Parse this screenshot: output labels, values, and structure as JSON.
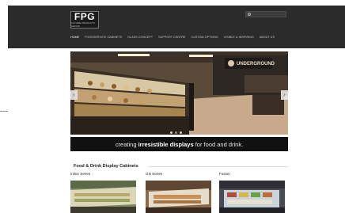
{
  "logo": {
    "text": "FPG",
    "subtext": "FUTURE PRODUCTS GROUP"
  },
  "search": {
    "icon": "search-icon"
  },
  "nav": {
    "items": [
      {
        "label": "HOME",
        "active": true
      },
      {
        "label": "FOODSERVICE CABINETS",
        "active": false
      },
      {
        "label": "GLASS CONCEPT",
        "active": false
      },
      {
        "label": "SUPPORT CENTRE",
        "active": false
      },
      {
        "label": "CUSTOM OPTIONS",
        "active": false
      },
      {
        "label": "VISIBLE & INSPIRING",
        "active": false
      },
      {
        "label": "ABOUT US",
        "active": false
      }
    ]
  },
  "slider": {
    "signage": "UNDERGROUND",
    "prev_icon": "chevron-left-icon",
    "next_icon": "chevron-right-icon",
    "slide_count": 3,
    "active_slide": 1
  },
  "tagline": {
    "pre": "creating ",
    "bold": "irresistible displays",
    "post": " for food and drink."
  },
  "section": {
    "title": "Food & Drink Display Cabinets",
    "columns": [
      {
        "label": "Inline Series"
      },
      {
        "label": "GN Series"
      },
      {
        "label": "Fusion"
      }
    ]
  }
}
